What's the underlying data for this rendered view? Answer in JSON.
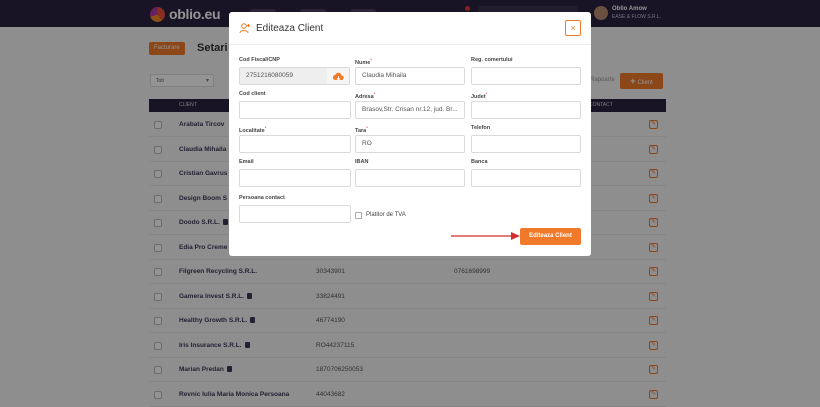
{
  "navbar": {
    "logo_text": "oblio.eu",
    "user_name": "Oblio Amow",
    "user_company": "EASE & FLOW S.R.L."
  },
  "page": {
    "breadcrumb": "Facturare",
    "title": "Setari",
    "filter_value": "Toti",
    "reports_label": "Rapoarte",
    "add_client_label": "Client",
    "table_headers": {
      "client": "CLIENT",
      "contact": "CONTACT"
    },
    "rows": [
      {
        "name": "Arabata Tircov",
        "cif": "",
        "phone": "",
        "lock": false
      },
      {
        "name": "Claudia Mihaila",
        "cif": "",
        "phone": "",
        "lock": false
      },
      {
        "name": "Cristian Gavrus",
        "cif": "",
        "phone": "",
        "lock": false
      },
      {
        "name": "Design Boom S",
        "cif": "",
        "phone": "",
        "lock": false
      },
      {
        "name": "Doodo S.R.L.",
        "cif": "",
        "phone": "",
        "lock": true
      },
      {
        "name": "Edia Pro Creme",
        "cif": "",
        "phone": "",
        "lock": false
      },
      {
        "name": "Filgreen Recycling S.R.L.",
        "cif": "30343901",
        "phone": "0761698999",
        "lock": false
      },
      {
        "name": "Gamera Invest S.R.L.",
        "cif": "33824491",
        "phone": "",
        "lock": true
      },
      {
        "name": "Healthy Growth S.R.L.",
        "cif": "46774190",
        "phone": "",
        "lock": true
      },
      {
        "name": "Iris Insurance S.R.L.",
        "cif": "RO44237115",
        "phone": "",
        "lock": true
      },
      {
        "name": "Marian Predan",
        "cif": "1870706250053",
        "phone": "",
        "lock": true
      },
      {
        "name": "Revnic Iulia Maria Monica Persoana",
        "cif": "44043682",
        "phone": "",
        "lock": false
      }
    ]
  },
  "modal": {
    "title": "Editeaza Client",
    "close_label": "×",
    "fields": {
      "cod_fiscal": {
        "label": "Cod Fiscal/CNP",
        "value": "2751216080059"
      },
      "nume": {
        "label": "Nume",
        "value": "Claudia Mihaila"
      },
      "reg_com": {
        "label": "Reg. comertului",
        "value": ""
      },
      "cod_client": {
        "label": "Cod client",
        "value": ""
      },
      "adresa": {
        "label": "Adresa",
        "value": "Brasov,Str. Crisan nr.12, jud. Br..."
      },
      "judet": {
        "label": "Judet",
        "value": ""
      },
      "localitate": {
        "label": "Localitate",
        "value": ""
      },
      "tara": {
        "label": "Tara",
        "value": "RO"
      },
      "telefon": {
        "label": "Telefon",
        "value": ""
      },
      "email": {
        "label": "Email",
        "value": ""
      },
      "iban": {
        "label": "IBAN",
        "value": ""
      },
      "banca": {
        "label": "Banca",
        "value": ""
      },
      "persoana_contact": {
        "label": "Persoana contact",
        "value": ""
      }
    },
    "tva_label": "Platitor de TVA",
    "submit_label": "Editeaza Client"
  },
  "colors": {
    "accent": "#f07a2a",
    "navbar": "#2a2140",
    "arrow": "#d32f2f"
  }
}
